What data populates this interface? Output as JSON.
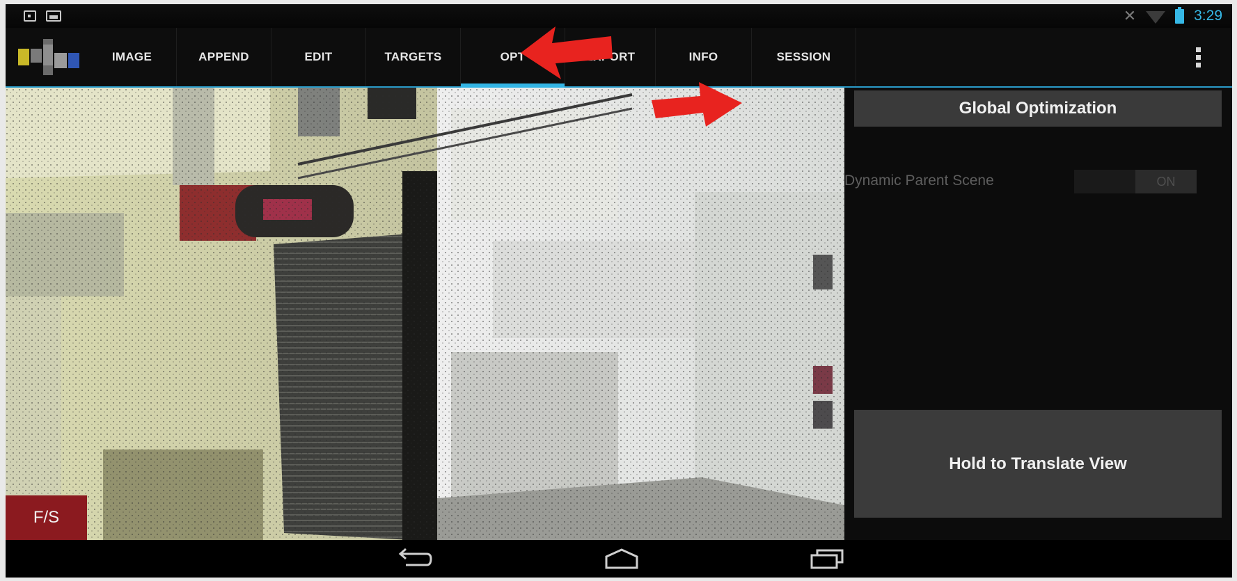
{
  "status_bar": {
    "time": "3:29",
    "icons": [
      "screenshot-icon",
      "gallery-icon",
      "notification-off-icon",
      "wifi-icon",
      "battery-icon"
    ]
  },
  "action_bar": {
    "tabs": [
      {
        "label": "IMAGE",
        "active": false
      },
      {
        "label": "APPEND",
        "active": false
      },
      {
        "label": "EDIT",
        "active": false
      },
      {
        "label": "TARGETS",
        "active": false
      },
      {
        "label": "OPT",
        "active": true
      },
      {
        "label": "EXPORT",
        "active": false
      },
      {
        "label": "INFO",
        "active": false
      },
      {
        "label": "SESSION",
        "active": false
      }
    ],
    "accent_color": "#33b5e5"
  },
  "viewport": {
    "fs_label": "F/S"
  },
  "side_panel": {
    "global_optimization_label": "Global Optimization",
    "dynamic_parent_scene_label": "Dynamic Parent Scene",
    "dynamic_parent_scene_state": "ON",
    "hold_translate_label": "Hold to Translate View"
  },
  "nav_bar": {
    "icons": [
      "back-icon",
      "home-icon",
      "recent-apps-icon"
    ]
  },
  "annotations": {
    "arrow_color": "#e8231f"
  }
}
